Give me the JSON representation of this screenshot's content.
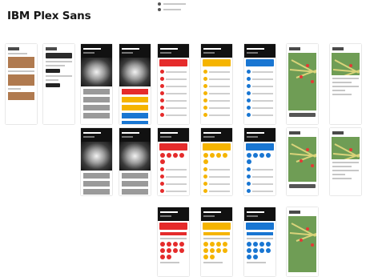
{
  "page": {
    "title": "IBM Plex Sans"
  },
  "palette": {
    "red": "#e52b2b",
    "yellow": "#f5b400",
    "blue": "#1976d2",
    "map_green": "#6f9d55",
    "dark": "#111111"
  },
  "frames": [
    {
      "id": "r1c1",
      "kind": "list-photo"
    },
    {
      "id": "r1c2",
      "kind": "form"
    },
    {
      "id": "r1c3",
      "kind": "storm-gray-bars"
    },
    {
      "id": "r1c4",
      "kind": "storm-colored-bars"
    },
    {
      "id": "r1c5",
      "kind": "list",
      "accent": "red"
    },
    {
      "id": "r1c6",
      "kind": "list",
      "accent": "yellow"
    },
    {
      "id": "r1c7",
      "kind": "list",
      "accent": "blue"
    },
    {
      "id": "r1c8",
      "kind": "map"
    },
    {
      "id": "r1c9",
      "kind": "detail-map"
    },
    {
      "id": "r2c3",
      "kind": "storm-gray-bars"
    },
    {
      "id": "r2c4",
      "kind": "storm-gray-bars"
    },
    {
      "id": "r2c5",
      "kind": "circles-list",
      "accent": "red"
    },
    {
      "id": "r2c6",
      "kind": "circles-list",
      "accent": "yellow"
    },
    {
      "id": "r2c7",
      "kind": "circles-list",
      "accent": "blue"
    },
    {
      "id": "r2c8",
      "kind": "map"
    },
    {
      "id": "r2c9",
      "kind": "detail-map"
    },
    {
      "id": "r3c5",
      "kind": "circles-big",
      "accent": "red"
    },
    {
      "id": "r3c6",
      "kind": "circles-big",
      "accent": "yellow"
    },
    {
      "id": "r3c7",
      "kind": "circles-big",
      "accent": "blue"
    },
    {
      "id": "r3c8",
      "kind": "map-tall"
    }
  ]
}
